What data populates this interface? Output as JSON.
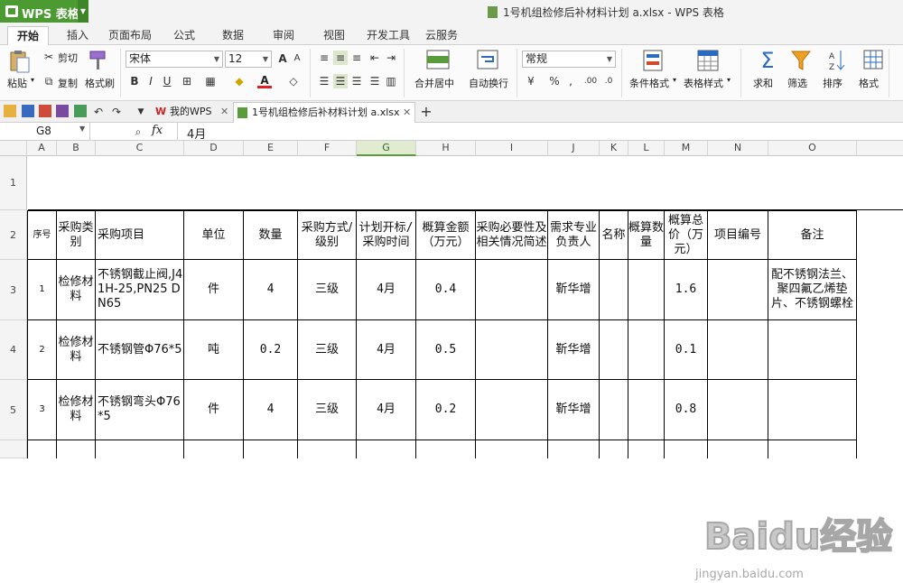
{
  "app": {
    "name": "WPS 表格",
    "window_title": "1号机组检修后补材料计划 a.xlsx - WPS 表格"
  },
  "ribbon_tabs": [
    "开始",
    "插入",
    "页面布局",
    "公式",
    "数据",
    "审阅",
    "视图",
    "开发工具",
    "云服务"
  ],
  "ribbon": {
    "paste": "粘贴",
    "cut": "剪切",
    "copy": "复制",
    "format_painter": "格式刷",
    "font_name": "宋体",
    "font_size": "12",
    "merge_center": "合并居中",
    "wrap_text": "自动换行",
    "number_format": "常规",
    "cond_format": "条件格式",
    "table_style": "表格样式",
    "sum": "求和",
    "filter": "筛选",
    "sort": "排序",
    "format": "格式",
    "bold": "B",
    "italic": "I",
    "underline": "U",
    "font_grow": "A",
    "font_shrink": "A",
    "percent": "%",
    "comma": ",",
    "currency": "¥"
  },
  "doc_tabs": [
    "我的WPS",
    "1号机组检修后补材料计划 a.xlsx"
  ],
  "formula_bar": {
    "cell_ref": "G8",
    "fx": "fx",
    "content": "4月"
  },
  "columns": [
    "A",
    "B",
    "C",
    "D",
    "E",
    "F",
    "G",
    "H",
    "I",
    "J",
    "K",
    "L",
    "M",
    "N",
    "O"
  ],
  "selected_column": "G",
  "row_numbers": [
    "1",
    "2",
    "3",
    "4",
    "5"
  ],
  "headers": [
    "序号",
    "采购类别",
    "采购项目",
    "单位",
    "数量",
    "采购方式/级别",
    "计划开标/采购时间",
    "概算金额（万元）",
    "采购必要性及相关情况简述",
    "需求专业负责人",
    "名称",
    "概算数量",
    "概算总价（万元）",
    "项目编号",
    "备注"
  ],
  "rows": [
    [
      "1",
      "检修材料",
      "不锈钢截止阀,J41H-25,PN25 DN65",
      "件",
      "4",
      "三级",
      "4月",
      "0.4",
      "",
      "靳华增",
      "",
      "",
      "1.6",
      "",
      "配不锈钢法兰、聚四氟乙烯垫片、不锈钢螺栓"
    ],
    [
      "2",
      "检修材料",
      "不锈钢管Φ76*5",
      "吨",
      "0.2",
      "三级",
      "4月",
      "0.5",
      "",
      "靳华增",
      "",
      "",
      "0.1",
      "",
      ""
    ],
    [
      "3",
      "检修材料",
      "不锈钢弯头Φ76*5",
      "件",
      "4",
      "三级",
      "4月",
      "0.2",
      "",
      "靳华增",
      "",
      "",
      "0.8",
      "",
      ""
    ]
  ],
  "watermark": {
    "text": "Baidu经验",
    "subtext": "jingyan.baidu.com"
  },
  "colors": {
    "accent": "#4c9a32",
    "selected_header": "#e1ebd2"
  }
}
